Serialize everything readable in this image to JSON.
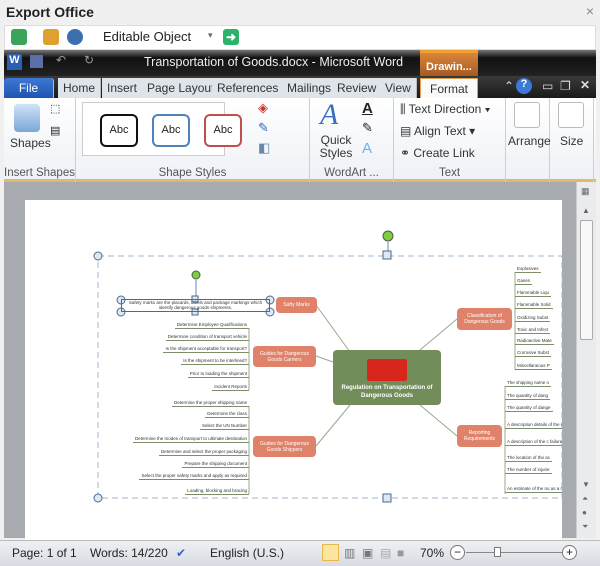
{
  "app": {
    "title": "Export Office",
    "close": "×"
  },
  "toolbar": {
    "mode": "Editable Object"
  },
  "word": {
    "title": "Transportation of Goods.docx  -  Microsoft Word",
    "context_tab": "Drawin...",
    "tabs": [
      "File",
      "Home",
      "Insert",
      "Page Layout",
      "References",
      "Mailings",
      "Review",
      "View",
      "Format"
    ]
  },
  "ribbon": {
    "shapes": "Shapes",
    "insert_shapes": "Insert Shapes",
    "style_sample": "Abc",
    "shape_styles": "Shape Styles",
    "quick_styles": "Quick Styles",
    "wordart": "WordArt ...",
    "text_direction": "Text Direction",
    "align_text": "Align Text",
    "create_link": "Create Link",
    "text_group": "Text",
    "arrange": "Arrange",
    "size": "Size"
  },
  "mindmap": {
    "center": "Regulation on Transportation of Dangerous Goods",
    "topics": {
      "safety": "Safty Marks",
      "carriers": "Guides for Dangerous Goods Carriers",
      "shippers": "Guides for Dangerous Goods Shippers",
      "classification": "Classification of Dangerous Goods",
      "reporting": "Reporting Requirements"
    },
    "safety_note": "Safety marks are the placards, labels and package markings which identify dangerous goods shipments.",
    "carriers": [
      "Determine Employee Qualifications",
      "Determine condition of transport vehicle",
      "Is the shipment acceptable for transport?",
      "Is the shipment to be interlined?",
      "Prior to loading the shipment",
      "Incident Reports"
    ],
    "shippers": [
      "Determine the proper shipping name",
      "Determine the class",
      "Select the UN Number",
      "Determine the modes of transport to ultimate destination",
      "Determine and select the proper packaging",
      "Prepare the shipping document",
      "Select the proper safety marks and apply as required",
      "Loading, blocking and bracing"
    ],
    "classification": [
      "Explosives",
      "Gases",
      "Flammable Liqu",
      "Flammable Solid",
      "Oxidizing Subst",
      "Toxic and Infect",
      "Radioactive Mate",
      "Corrosive Subst",
      "Miscellaneous P"
    ],
    "reporting": [
      "The shipping name o",
      "The quantity of dang",
      "The quantity of dange",
      "A description details of the conditio",
      "A description of the c failure of a c",
      "The location of the ac",
      "The number of injurie",
      "An estimate of the nu as a result of th"
    ]
  },
  "status": {
    "page": "Page: 1 of 1",
    "words": "Words: 14/220",
    "language": "English (U.S.)",
    "zoom": "70%",
    "zoom_level": 70
  },
  "colors": {
    "center": "#728c5a",
    "topic": "#e0826a",
    "accent": "#e3b86a"
  }
}
